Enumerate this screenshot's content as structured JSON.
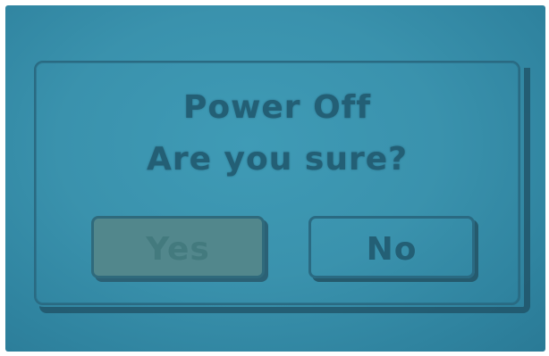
{
  "dialog": {
    "title": "Power Off",
    "message": "Are you sure?",
    "buttons": {
      "yes_label": "Yes",
      "no_label": "No"
    },
    "selected_button": "Yes"
  },
  "colors": {
    "screen_background": "#3a92ad",
    "text": "#235f75",
    "selected_button_fill": "#52878c"
  }
}
